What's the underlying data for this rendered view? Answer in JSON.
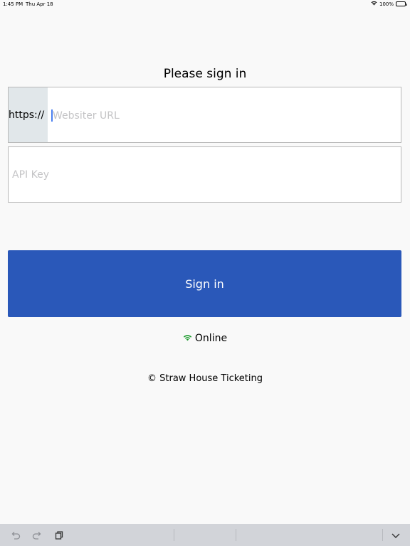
{
  "status_bar": {
    "time": "1:45 PM",
    "date": "Thu Apr 18",
    "battery": "100%"
  },
  "page_title": "Please sign in",
  "url_field": {
    "prefix": "https://",
    "placeholder": "Websiter URL"
  },
  "api_key_field": {
    "placeholder": "API Key"
  },
  "sign_in_button": "Sign in",
  "connection_status": "Online",
  "copyright": "© Straw House Ticketing",
  "colors": {
    "background": "#f9f9f9",
    "button": "#2a58b9",
    "prefix_bg": "#e1e7ea",
    "online_icon": "#1a9a2b",
    "shortcut_bar": "#d2d4d9"
  },
  "icons": {
    "wifi": "wifi-icon",
    "undo": "undo-icon",
    "redo": "redo-icon",
    "paste": "paste-icon",
    "dismiss_keyboard": "chevron-down-icon"
  }
}
